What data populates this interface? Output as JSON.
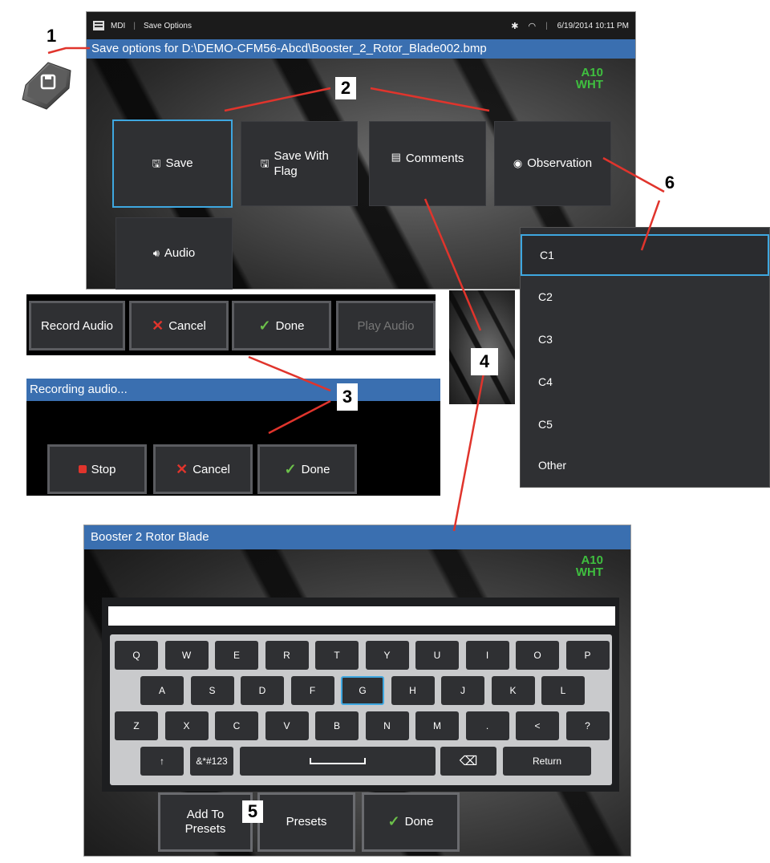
{
  "callouts": [
    "1",
    "2",
    "3",
    "4",
    "5",
    "6"
  ],
  "save_screen": {
    "status_bar": {
      "app": "MDI",
      "section": "Save Options",
      "datetime": "6/19/2014 10:11 PM",
      "icons": [
        "menu-icon",
        "bluetooth-icon",
        "wifi-icon"
      ]
    },
    "title": "Save options for D:\\DEMO-CFM56-Abcd\\Booster_2_Rotor_Blade002.bmp",
    "probe_tag": {
      "line1": "A10",
      "line2": "WHT"
    },
    "tiles": {
      "save": "Save",
      "save_with_flag": "Save With Flag",
      "comments": "Comments",
      "observation": "Observation",
      "audio": "Audio"
    }
  },
  "audio_bar": {
    "record": "Record Audio",
    "cancel": "Cancel",
    "done": "Done",
    "play": "Play Audio"
  },
  "recording": {
    "title": "Recording audio...",
    "stop": "Stop",
    "cancel": "Cancel",
    "done": "Done"
  },
  "observation_menu": {
    "items": [
      "C1",
      "C2",
      "C3",
      "C4",
      "C5",
      "Other"
    ],
    "selected": "C1"
  },
  "keyboard_screen": {
    "title": "Booster 2 Rotor Blade",
    "probe_tag": {
      "line1": "A10",
      "line2": "WHT"
    },
    "input_value": "",
    "row1": [
      "Q",
      "W",
      "E",
      "R",
      "T",
      "Y",
      "U",
      "I",
      "O",
      "P"
    ],
    "row2": [
      "A",
      "S",
      "D",
      "F",
      "G",
      "H",
      "J",
      "K",
      "L"
    ],
    "row3": [
      "Z",
      "X",
      "C",
      "V",
      "B",
      "N",
      "M",
      ".",
      "<",
      "?"
    ],
    "row4": {
      "shift": "↑",
      "symbols": "&*#123",
      "return": "Return"
    },
    "selected_key": "G",
    "buttons": {
      "add_to_presets": "Add To Presets",
      "presets": "Presets",
      "done": "Done"
    }
  },
  "colors": {
    "title_bar": "#3a6fb0",
    "selection": "#3ea7e0",
    "probe_tag": "#3fbf3f",
    "callout_line": "#e0342c"
  }
}
